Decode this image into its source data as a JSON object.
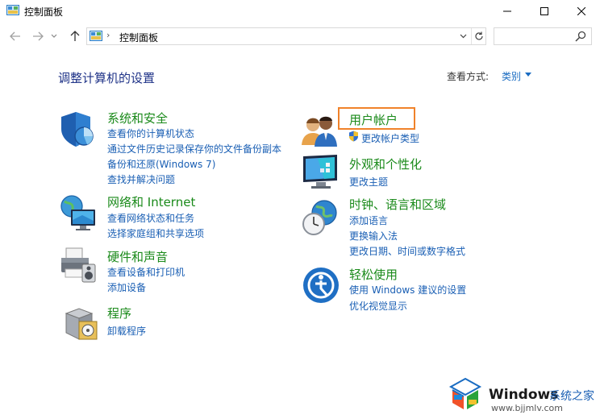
{
  "window": {
    "title": "控制面板"
  },
  "address": {
    "path": "控制面板",
    "separator": "›",
    "search_placeholder": ""
  },
  "heading": {
    "title": "调整计算机的设置",
    "view_by_label": "查看方式:",
    "view_by_value": "类别"
  },
  "categories": {
    "security": {
      "title": "系统和安全",
      "links": [
        "查看你的计算机状态",
        "通过文件历史记录保存你的文件备份副本",
        "备份和还原(Windows 7)",
        "查找并解决问题"
      ]
    },
    "network": {
      "title": "网络和 Internet",
      "links": [
        "查看网络状态和任务",
        "选择家庭组和共享选项"
      ]
    },
    "hardware": {
      "title": "硬件和声音",
      "links": [
        "查看设备和打印机",
        "添加设备"
      ]
    },
    "programs": {
      "title": "程序",
      "links": [
        "卸载程序"
      ]
    },
    "accounts": {
      "title": "用户帐户",
      "links": [
        "更改帐户类型"
      ]
    },
    "appearance": {
      "title": "外观和个性化",
      "links": [
        "更改主题"
      ]
    },
    "clock": {
      "title": "时钟、语言和区域",
      "links": [
        "添加语言",
        "更换输入法",
        "更改日期、时间或数字格式"
      ]
    },
    "ease": {
      "title": "轻松使用",
      "links": [
        "使用 Windows 建议的设置",
        "优化视觉显示"
      ]
    }
  },
  "watermark": {
    "brand": "Windows",
    "brand_suffix": "系统之家",
    "url": "www.bjjmlv.com"
  },
  "colors": {
    "heading": "#1e3287",
    "category_title": "#1a8a1a",
    "link": "#1a5fb4",
    "highlight": "#f0822a"
  },
  "icons": [
    "control-panel-icon",
    "minimize-icon",
    "maximize-icon",
    "close-icon",
    "back-arrow-icon",
    "forward-arrow-icon",
    "up-arrow-icon",
    "refresh-icon",
    "search-icon",
    "security-shield-icon",
    "network-globe-icon",
    "printer-icon",
    "programs-box-icon",
    "users-icon",
    "monitor-icon",
    "clock-globe-icon",
    "ease-of-access-icon",
    "uac-shield-icon",
    "windows-logo-icon"
  ]
}
